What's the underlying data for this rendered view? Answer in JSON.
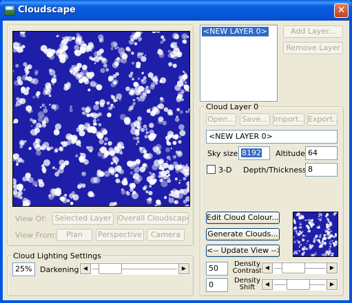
{
  "window": {
    "title": "Cloudscape",
    "close_glyph": "✕"
  },
  "preview": {
    "view_of_label": "View Of:",
    "selected_layer": "Selected Layer",
    "overall_cloudscape": "Overall Cloudscape",
    "view_from_label": "View From:",
    "plan": "Plan",
    "perspective": "Perspective",
    "camera": "Camera"
  },
  "lighting": {
    "group_label": "Cloud Lighting Settings",
    "value": "25%",
    "darkening_label": "Darkening",
    "darkening_level": 0.12
  },
  "layers": {
    "items": [
      "<NEW LAYER 0>"
    ],
    "add_layer": "Add Layer...",
    "remove_layer": "Remove Layer"
  },
  "cloud_layer": {
    "group_label": "Cloud Layer 0",
    "open": "Open...",
    "save": "Save...",
    "import": "Import...",
    "export": "Export...",
    "name": "<NEW LAYER 0>",
    "sky_size_label": "Sky size",
    "sky_size": "8192",
    "altitude_label": "Altitude",
    "altitude": "64",
    "three_d_label": "3-D",
    "three_d_checked": false,
    "depth_label": "Depth/Thickness",
    "depth": "8",
    "edit_colour": "Edit Cloud Colour...",
    "generate": "Generate Clouds...",
    "update_view": "<-- Update View -->",
    "density_contrast_value": "50",
    "density_contrast_label1": "Density",
    "density_contrast_label2": "Contrast",
    "density_contrast_level": 0.3,
    "density_shift_value": "0",
    "density_shift_label1": "Density",
    "density_shift_label2": "Shift",
    "density_shift_level": 0.45
  },
  "colors": {
    "sky": "#1e1ea8",
    "cloud": "#ffffff",
    "accent": "#316ac5"
  },
  "icons": {
    "arrow_left": "◀",
    "arrow_right": "▶"
  }
}
